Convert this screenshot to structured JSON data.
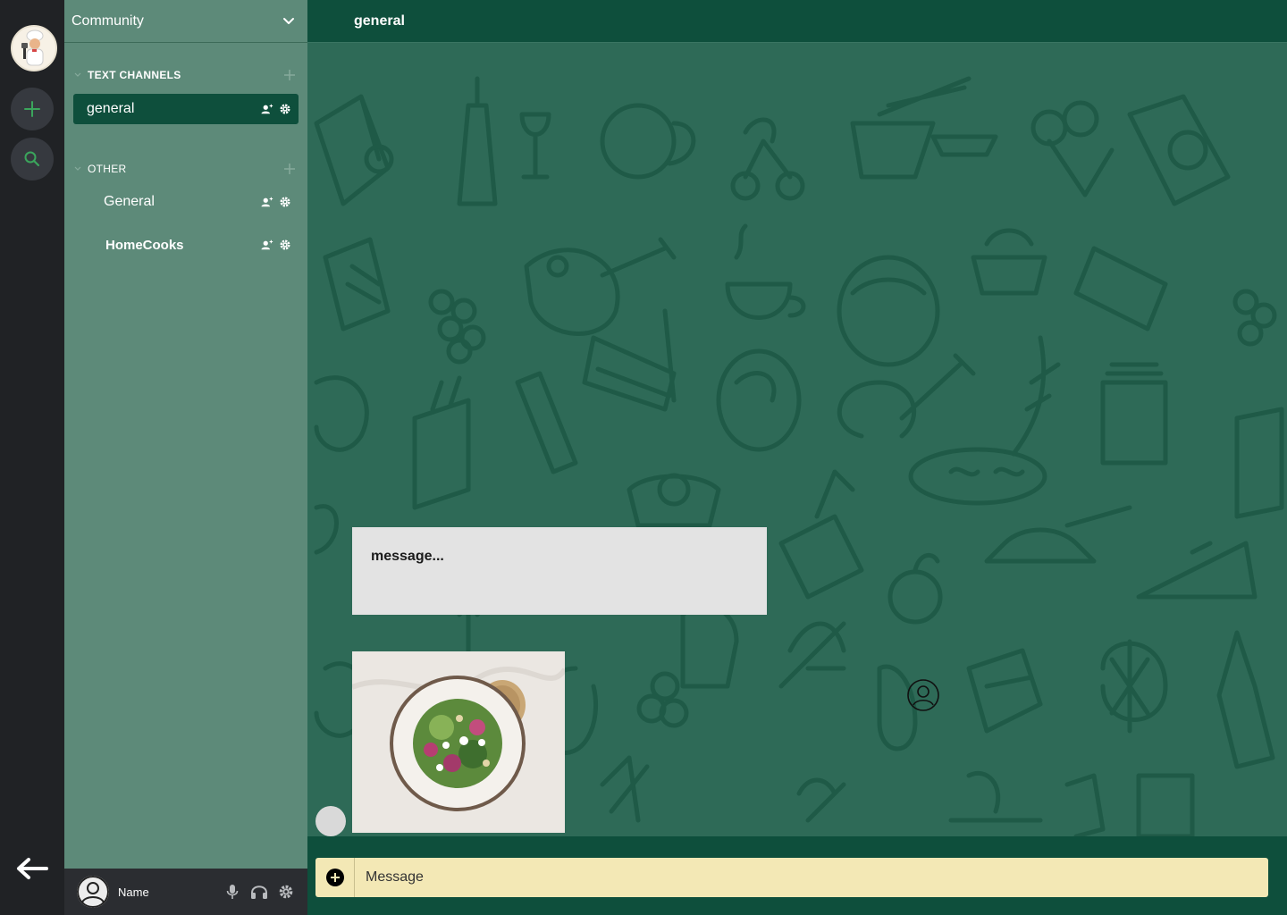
{
  "server": {
    "name": "Community"
  },
  "categories": [
    {
      "label": "TEXT CHANNELS"
    },
    {
      "label": "OTHER"
    }
  ],
  "channels": [
    {
      "name": "general",
      "active": true
    },
    {
      "name": "General",
      "active": false
    },
    {
      "name": "HomeCooks",
      "active": false
    }
  ],
  "header": {
    "channel_title": "general"
  },
  "messages": [
    {
      "text": "message..."
    }
  ],
  "composer": {
    "placeholder": "Message"
  },
  "user": {
    "name": "Name"
  },
  "colors": {
    "rail": "#202225",
    "sidebar": "#5d8a79",
    "main_bg": "#2e6a57",
    "header": "#0e4f3c",
    "accent": "#3ba55c",
    "composer": "#f3e8b5"
  }
}
